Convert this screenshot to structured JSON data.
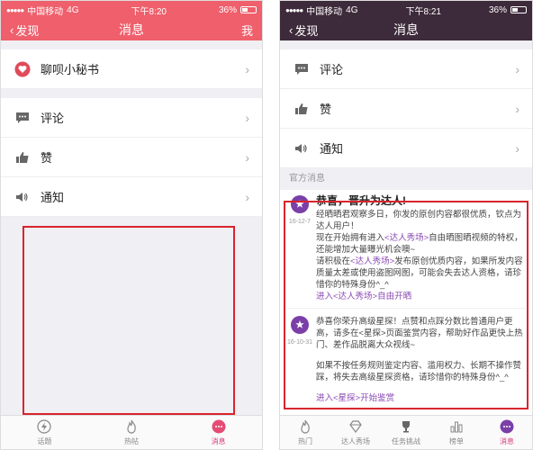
{
  "colors": {
    "pink": "#ef5f6c",
    "purple": "#3d2a3a",
    "accent": "#d63a78",
    "highlight": "#d8252c",
    "link": "#8a4ab3"
  },
  "left": {
    "status": {
      "carrier": "中国移动",
      "network": "4G",
      "time": "下午8:20",
      "battery": "36%"
    },
    "nav": {
      "back": "发现",
      "title": "消息",
      "right": "我"
    },
    "items": [
      {
        "label": "聊呗小秘书",
        "icon": "heart-badge-icon"
      },
      {
        "label": "评论",
        "icon": "comment-icon"
      },
      {
        "label": "赞",
        "icon": "thumbs-up-icon"
      },
      {
        "label": "通知",
        "icon": "speaker-icon"
      }
    ],
    "tabs": [
      {
        "label": "话题",
        "icon": "lightning-icon"
      },
      {
        "label": "热帖",
        "icon": "flame-icon"
      },
      {
        "label": "消息",
        "icon": "chat-bubble-icon"
      }
    ]
  },
  "right": {
    "status": {
      "carrier": "中国移动",
      "network": "4G",
      "time": "下午8:21",
      "battery": "36%"
    },
    "nav": {
      "back": "发现",
      "title": "消息"
    },
    "items": [
      {
        "label": "评论",
        "icon": "comment-icon"
      },
      {
        "label": "赞",
        "icon": "thumbs-up-icon"
      },
      {
        "label": "通知",
        "icon": "speaker-icon"
      }
    ],
    "section_label": "官方消息",
    "messages": [
      {
        "date": "16-12-7",
        "title": "恭喜，晋升为达人!",
        "lines": [
          "经晒晒君观察多日，你发的原创内容都很优质，钦点为达人用户！",
          "现在开始拥有进入",
          "<达人秀场>",
          "自由晒图晒视频的特权，还能增加大量曝光机会噢~",
          "请积极在",
          "<达人秀场>",
          "发布原创优质内容，如果所发内容质量太差或使用盗图网图，可能会失去达人资格，请珍惜你的特殊身份^_^",
          "进入<达人秀场>自由开晒"
        ]
      },
      {
        "date": "16-10-31",
        "p1": "恭喜你荣升高级星探！点赞和点踩分数比普通用户更高，请多在<星探>页面鉴赏内容，帮助好作品更快上热门、差作品脱离大众视线~",
        "p2": "如果不按任务规则鉴定内容、滥用权力、长期不操作赞踩，将失去高级星探资格，请珍惜你的特殊身份^_^",
        "link": "进入<星探>开始鉴赏"
      }
    ],
    "tabs": [
      {
        "label": "热门",
        "icon": "flame-icon"
      },
      {
        "label": "达人秀场",
        "icon": "diamond-icon"
      },
      {
        "label": "任务挑战",
        "icon": "trophy-icon"
      },
      {
        "label": "榜单",
        "icon": "bar-chart-icon"
      },
      {
        "label": "消息",
        "icon": "chat-bubble-icon"
      }
    ]
  }
}
